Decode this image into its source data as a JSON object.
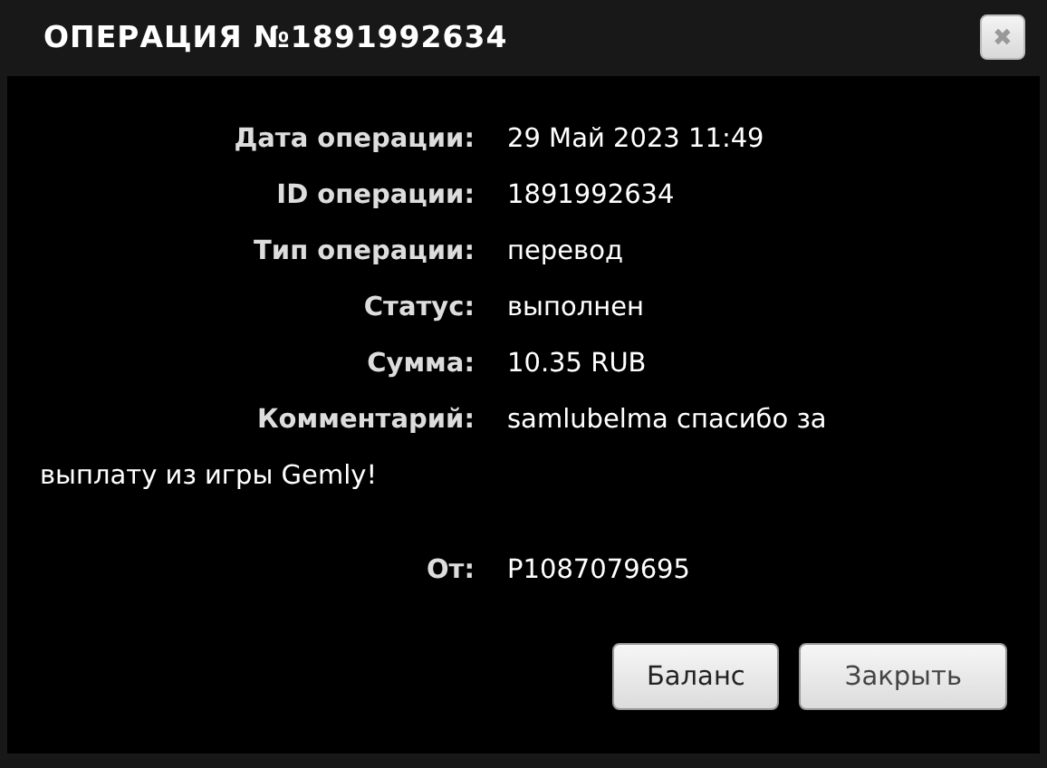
{
  "window": {
    "title": "ОПЕРАЦИЯ №1891992634",
    "close": "✖"
  },
  "fields": [
    {
      "label": "Дата операции:",
      "value": "29 Май 2023 11:49"
    },
    {
      "label": "ID операции:",
      "value": "1891992634"
    },
    {
      "label": "Тип операции:",
      "value": "перевод"
    },
    {
      "label": "Статус:",
      "value": "выполнен"
    },
    {
      "label": "Сумма:",
      "value": "10.35 RUB"
    },
    {
      "label": "Комментарий:",
      "value": "samlubelma спасибо за",
      "continuation": "выплату из игры Gemly!"
    }
  ],
  "from": {
    "label": "От:",
    "value": "P1087079695"
  },
  "buttons": [
    "Баланс",
    "Закрыть"
  ]
}
